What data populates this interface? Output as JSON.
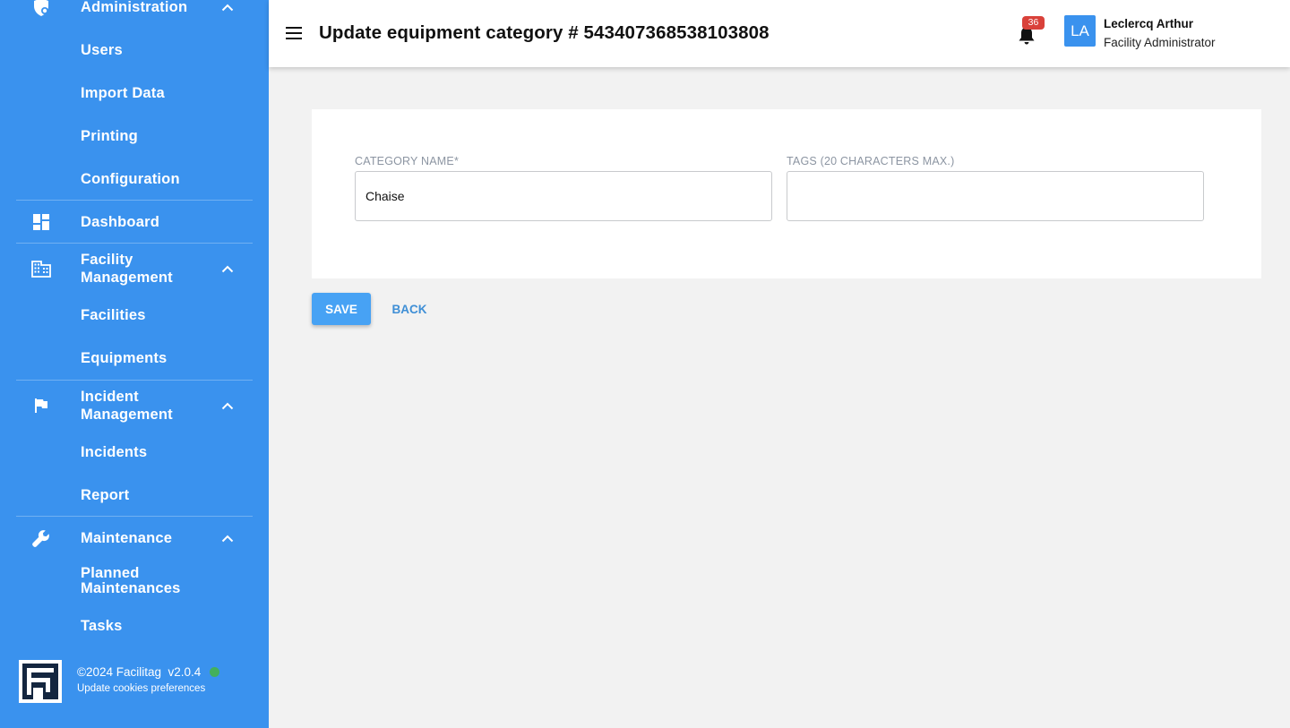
{
  "sidebar": {
    "administration": {
      "label": "Administration",
      "icon": "shield-gear-icon"
    },
    "users": "Users",
    "import_data": "Import Data",
    "printing": "Printing",
    "configuration": "Configuration",
    "dashboard": {
      "label": "Dashboard",
      "icon": "dashboard-icon"
    },
    "facility_management": {
      "label": "Facility\nManagement",
      "icon": "building-icon"
    },
    "facilities": "Facilities",
    "equipments": "Equipments",
    "incident_management": {
      "label": "Incident\nManagement",
      "icon": "flag-icon"
    },
    "incidents": "Incidents",
    "report": "Report",
    "maintenance": {
      "label": "Maintenance",
      "icon": "wrench-icon"
    },
    "planned_maintenances": "Planned\nMaintenances",
    "tasks": "Tasks",
    "footer": {
      "copyright": "©2024 Facilitag  v2.0.4",
      "cookies": "Update cookies preferences"
    }
  },
  "header": {
    "title": "Update equipment category # 543407368538103808",
    "notifications_count": "36",
    "user_initials": "LA",
    "user_name": "Leclercq Arthur",
    "user_role": "Facility Administrator"
  },
  "form": {
    "category_name_label": "CATEGORY NAME*",
    "category_name_value": "Chaise",
    "tags_label": "TAGS (20 CHARACTERS MAX.)",
    "tags_value": ""
  },
  "actions": {
    "save": "SAVE",
    "back": "BACK"
  },
  "colors": {
    "sidebar_bg": "#3a92ee",
    "primary_button": "#47a2f4",
    "badge": "#d9413a",
    "status_online": "#43b05c"
  }
}
